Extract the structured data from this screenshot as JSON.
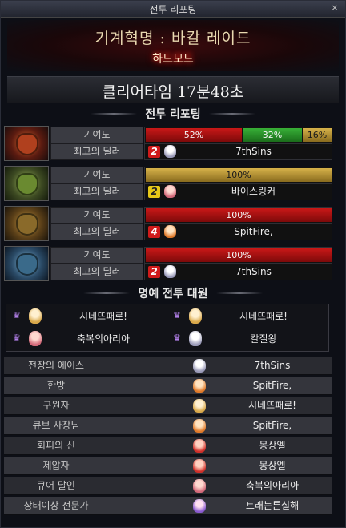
{
  "window": {
    "title": "전투 리포팅",
    "close_icon": "×"
  },
  "raid": {
    "title": "기계혁명 : 바칼 레이드",
    "mode": "하드모드"
  },
  "clear_time": "클리어타임 17분48초",
  "sections": {
    "battle_report": "전투 리포팅",
    "honor": "명예 전투 대원"
  },
  "labels": {
    "contribution": "기여도",
    "best_dealer": "최고의 딜러"
  },
  "parties": [
    {
      "contribution": [
        {
          "value": "52%",
          "pct": 52,
          "color": "red"
        },
        {
          "value": "32%",
          "pct": 32,
          "color": "green"
        },
        {
          "value": "16%",
          "pct": 16,
          "color": "gold"
        }
      ],
      "dealer": {
        "party": "2",
        "name": "7thSins"
      }
    },
    {
      "contribution": [
        {
          "value": "100%",
          "pct": 100,
          "color": "gold"
        }
      ],
      "dealer": {
        "party": "2",
        "name": "바이스링커"
      }
    },
    {
      "contribution": [
        {
          "value": "100%",
          "pct": 100,
          "color": "red"
        }
      ],
      "dealer": {
        "party": "4",
        "name": "SpitFire,"
      }
    },
    {
      "contribution": [
        {
          "value": "100%",
          "pct": 100,
          "color": "red"
        }
      ],
      "dealer": {
        "party": "2",
        "name": "7thSins"
      }
    }
  ],
  "honor": [
    "시네뜨패로!",
    "시네뜨패로!",
    "축복의아리아",
    "칼질왕"
  ],
  "awards": [
    {
      "title": "전장의 에이스",
      "player": "7thSins"
    },
    {
      "title": "한방",
      "player": "SpitFire,"
    },
    {
      "title": "구원자",
      "player": "시네뜨패로!"
    },
    {
      "title": "큐브 사장님",
      "player": "SpitFire,"
    },
    {
      "title": "회피의 신",
      "player": "몽상엘"
    },
    {
      "title": "제압자",
      "player": "몽상엘"
    },
    {
      "title": "큐어 달인",
      "player": "축복의아리아"
    },
    {
      "title": "상태이상 전문가",
      "player": "트래는튼실해"
    }
  ]
}
